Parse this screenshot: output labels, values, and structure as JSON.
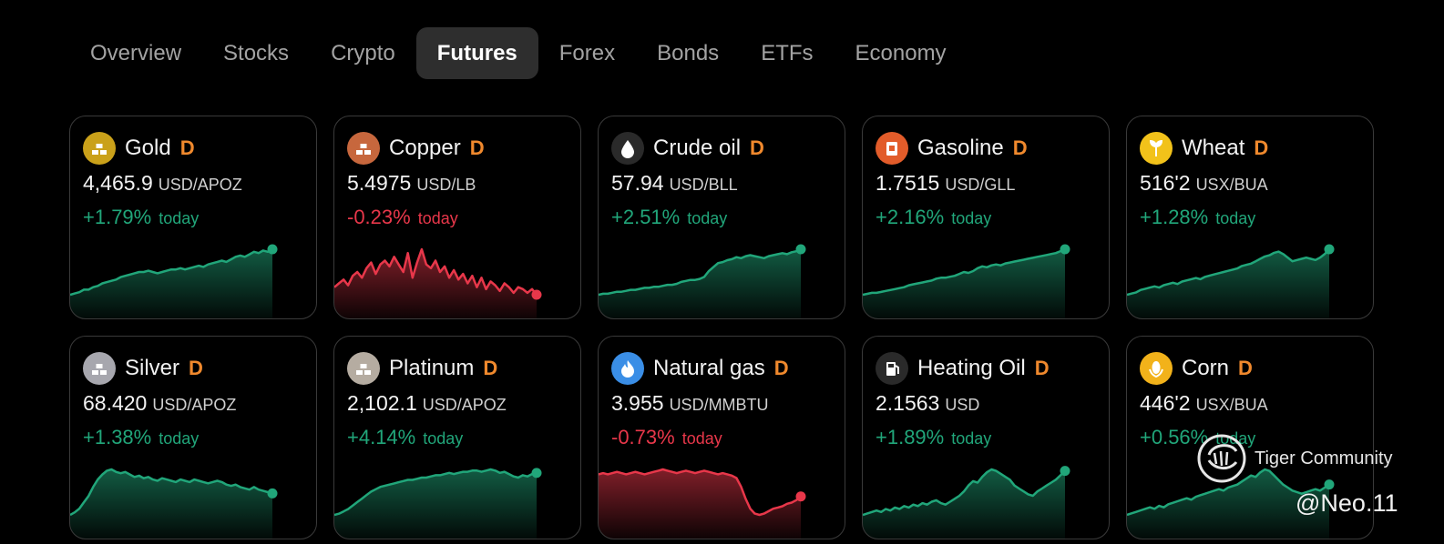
{
  "tabs": [
    {
      "label": "Overview",
      "active": false
    },
    {
      "label": "Stocks",
      "active": false
    },
    {
      "label": "Crypto",
      "active": false
    },
    {
      "label": "Futures",
      "active": true
    },
    {
      "label": "Forex",
      "active": false
    },
    {
      "label": "Bonds",
      "active": false
    },
    {
      "label": "ETFs",
      "active": false
    },
    {
      "label": "Economy",
      "active": false
    }
  ],
  "colors": {
    "positive": "#21a67a",
    "negative": "#e8374a",
    "badge": "#f0892d",
    "card_border": "#3a3a3a"
  },
  "cards": [
    {
      "name": "Gold",
      "badge": "D",
      "price": "4,465.9",
      "unit": "USD/APOZ",
      "change": "+1.79%",
      "period": "today",
      "direction": "up",
      "icon": "gold-bars-icon",
      "icon_bg": "#caa11a",
      "series": [
        40,
        41,
        42,
        44,
        44,
        46,
        47,
        49,
        50,
        51,
        52,
        54,
        55,
        56,
        57,
        58,
        58,
        59,
        58,
        57,
        58,
        59,
        60,
        60,
        61,
        60,
        61,
        62,
        63,
        62,
        64,
        65,
        66,
        67,
        66,
        68,
        70,
        71,
        70,
        72,
        74,
        73,
        75,
        74,
        76
      ]
    },
    {
      "name": "Copper",
      "badge": "D",
      "price": "5.4975",
      "unit": "USD/LB",
      "change": "-0.23%",
      "period": "today",
      "direction": "down",
      "icon": "copper-bars-icon",
      "icon_bg": "#c7673d",
      "series": [
        50,
        52,
        54,
        51,
        56,
        58,
        55,
        60,
        63,
        57,
        62,
        64,
        61,
        66,
        62,
        58,
        68,
        55,
        63,
        70,
        62,
        60,
        64,
        58,
        61,
        55,
        59,
        54,
        57,
        52,
        56,
        50,
        55,
        49,
        53,
        51,
        48,
        52,
        50,
        47,
        50,
        49,
        47,
        49,
        46
      ]
    },
    {
      "name": "Crude oil",
      "badge": "D",
      "price": "57.94",
      "unit": "USD/BLL",
      "change": "+2.51%",
      "period": "today",
      "direction": "up",
      "icon": "oil-drop-icon",
      "icon_bg": "#2a2a2a",
      "series": [
        42,
        43,
        43,
        44,
        45,
        45,
        46,
        47,
        47,
        48,
        49,
        49,
        50,
        50,
        51,
        52,
        52,
        53,
        55,
        56,
        57,
        57,
        58,
        60,
        66,
        70,
        74,
        75,
        77,
        78,
        80,
        79,
        81,
        82,
        81,
        80,
        79,
        81,
        82,
        83,
        84,
        83,
        85,
        86,
        88
      ]
    },
    {
      "name": "Gasoline",
      "badge": "D",
      "price": "1.7515",
      "unit": "USD/GLL",
      "change": "+2.16%",
      "period": "today",
      "direction": "up",
      "icon": "fuel-can-icon",
      "icon_bg": "#e25c2a",
      "series": [
        40,
        41,
        42,
        42,
        43,
        44,
        45,
        46,
        47,
        48,
        50,
        51,
        52,
        53,
        54,
        55,
        57,
        58,
        58,
        59,
        60,
        62,
        64,
        63,
        65,
        68,
        70,
        69,
        71,
        72,
        71,
        73,
        74,
        75,
        76,
        77,
        78,
        79,
        80,
        81,
        82,
        83,
        84,
        86,
        88
      ]
    },
    {
      "name": "Wheat",
      "badge": "D",
      "price": "516'2",
      "unit": "USX/BUA",
      "change": "+1.28%",
      "period": "today",
      "direction": "up",
      "icon": "wheat-icon",
      "icon_bg": "#f2c21a",
      "series": [
        42,
        43,
        44,
        46,
        47,
        48,
        49,
        48,
        50,
        51,
        52,
        51,
        53,
        54,
        55,
        56,
        55,
        57,
        58,
        59,
        60,
        61,
        62,
        63,
        64,
        66,
        67,
        68,
        70,
        72,
        74,
        75,
        77,
        78,
        76,
        73,
        70,
        71,
        72,
        73,
        72,
        71,
        73,
        76,
        80
      ]
    },
    {
      "name": "Silver",
      "badge": "D",
      "price": "68.420",
      "unit": "USD/APOZ",
      "change": "+1.38%",
      "period": "today",
      "direction": "up",
      "icon": "silver-bars-icon",
      "icon_bg": "#a7a7ae",
      "series": [
        40,
        42,
        45,
        50,
        55,
        62,
        68,
        72,
        75,
        76,
        74,
        73,
        74,
        72,
        70,
        71,
        69,
        70,
        68,
        67,
        69,
        68,
        67,
        66,
        68,
        67,
        66,
        68,
        67,
        66,
        65,
        66,
        67,
        66,
        64,
        63,
        64,
        62,
        61,
        60,
        62,
        60,
        59,
        58,
        57
      ]
    },
    {
      "name": "Platinum",
      "badge": "D",
      "price": "2,102.1",
      "unit": "USD/APOZ",
      "change": "+4.14%",
      "period": "today",
      "direction": "up",
      "icon": "platinum-bars-icon",
      "icon_bg": "#b5aca1",
      "series": [
        40,
        41,
        43,
        45,
        48,
        51,
        54,
        57,
        60,
        62,
        64,
        65,
        66,
        67,
        68,
        69,
        70,
        70,
        71,
        72,
        72,
        73,
        74,
        74,
        75,
        76,
        75,
        76,
        77,
        77,
        78,
        78,
        77,
        78,
        79,
        78,
        76,
        77,
        75,
        73,
        72,
        74,
        73,
        75,
        76
      ]
    },
    {
      "name": "Natural gas",
      "badge": "D",
      "price": "3.955",
      "unit": "USD/MMBTU",
      "change": "-0.73%",
      "period": "today",
      "direction": "down",
      "icon": "flame-icon",
      "icon_bg": "#3a8ee6",
      "series": [
        70,
        71,
        70,
        71,
        72,
        71,
        70,
        71,
        72,
        71,
        70,
        71,
        72,
        73,
        74,
        73,
        72,
        71,
        72,
        73,
        72,
        71,
        72,
        73,
        72,
        71,
        70,
        71,
        70,
        69,
        67,
        60,
        50,
        42,
        38,
        37,
        38,
        40,
        42,
        43,
        44,
        46,
        47,
        49,
        52
      ]
    },
    {
      "name": "Heating Oil",
      "badge": "D",
      "price": "2.1563",
      "unit": "USD",
      "change": "+1.89%",
      "period": "today",
      "direction": "up",
      "icon": "fuel-pump-icon",
      "icon_bg": "#2a2a2a",
      "series": [
        40,
        41,
        42,
        43,
        42,
        44,
        43,
        45,
        44,
        46,
        45,
        47,
        46,
        48,
        47,
        49,
        50,
        48,
        47,
        49,
        51,
        53,
        56,
        60,
        63,
        62,
        66,
        69,
        71,
        70,
        68,
        66,
        64,
        60,
        58,
        56,
        54,
        53,
        56,
        58,
        60,
        62,
        64,
        67,
        70
      ]
    },
    {
      "name": "Corn",
      "badge": "D",
      "price": "446'2",
      "unit": "USX/BUA",
      "change": "+0.56%",
      "period": "today",
      "direction": "up",
      "icon": "corn-icon",
      "icon_bg": "#f2b21a",
      "series": [
        40,
        41,
        42,
        43,
        44,
        45,
        44,
        46,
        45,
        47,
        48,
        49,
        50,
        51,
        50,
        52,
        53,
        54,
        55,
        56,
        57,
        56,
        58,
        59,
        60,
        62,
        64,
        66,
        65,
        68,
        70,
        69,
        66,
        63,
        60,
        58,
        56,
        55,
        54,
        55,
        56,
        57,
        56,
        58,
        60
      ]
    }
  ],
  "watermark": {
    "label": "Tiger Community",
    "handle": "@Neo.11",
    "icon": "tiger-logo-icon"
  }
}
